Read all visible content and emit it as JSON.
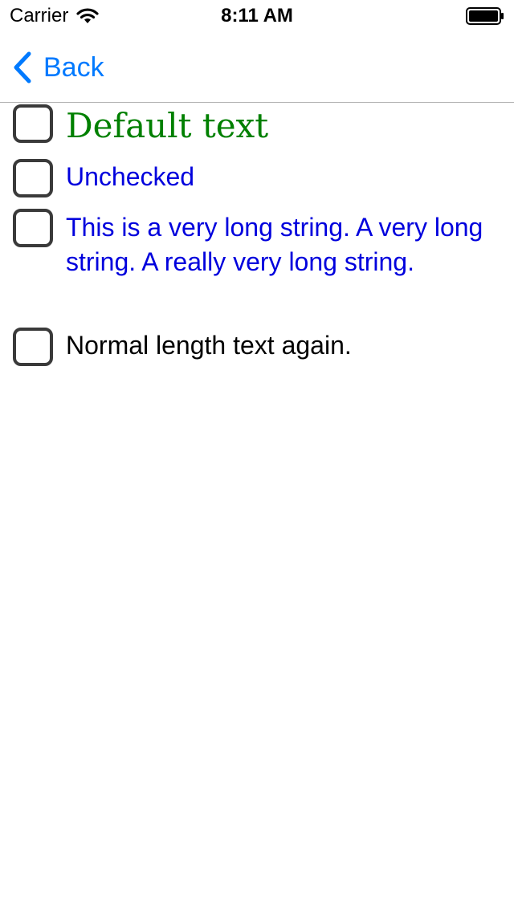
{
  "status_bar": {
    "carrier": "Carrier",
    "time": "8:11 AM",
    "wifi_icon": "wifi-icon",
    "battery_icon": "battery-icon"
  },
  "nav": {
    "back_label": "Back",
    "back_icon": "chevron-left-icon",
    "tint_color": "#007aff"
  },
  "checkboxes": [
    {
      "label": "Default text",
      "checked": false,
      "color": "#008000"
    },
    {
      "label": "Unchecked",
      "checked": false,
      "color": "#0000dd"
    },
    {
      "label": "This is a very long string. A very long string. A really very long string.",
      "checked": false,
      "color": "#0000dd"
    },
    {
      "label": "Normal length text again.",
      "checked": false,
      "color": "#000000"
    }
  ]
}
